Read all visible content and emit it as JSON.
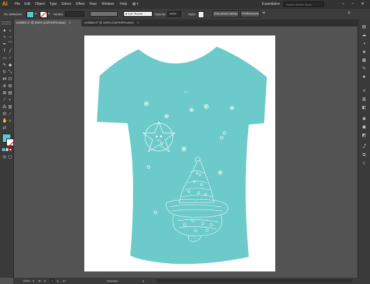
{
  "app": {
    "logo": "Ai"
  },
  "menu": [
    "File",
    "Edit",
    "Object",
    "Type",
    "Select",
    "Effect",
    "View",
    "Window",
    "Help"
  ],
  "workspace": {
    "label": "Essentials",
    "search_placeholder": "Search Adobe Stock"
  },
  "control": {
    "selection_label": "No Selection",
    "stroke_label": "Stroke:",
    "brush_label": "5 pt. Round",
    "opacity_label": "Opacity:",
    "opacity_value": "100%",
    "style_label": "Style:",
    "doc_setup": "Document Setup",
    "preferences": "Preferences",
    "fill_color": "#5cc8c8"
  },
  "tabs": [
    {
      "label": "Untitled-1* @ 200% (CMYK/Preview)",
      "close": "×"
    },
    {
      "label": "Untitled-2* @ 100% (CMYK/Preview)",
      "close": "×"
    }
  ],
  "status": {
    "zoom": "200%",
    "page": "1",
    "tool": "Selection"
  },
  "artwork": {
    "shirt_color": "#6ccaca",
    "line_color": "#ffffff",
    "tiny_text": "lumo"
  }
}
